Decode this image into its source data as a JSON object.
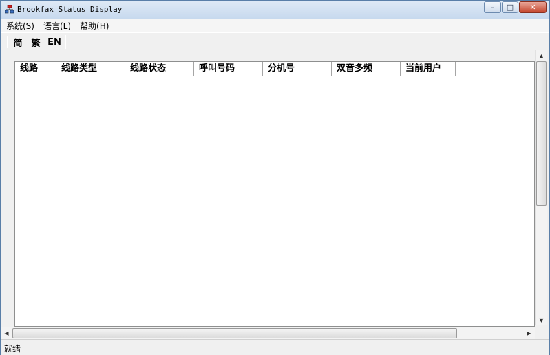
{
  "window": {
    "title": "Brookfax Status Display"
  },
  "window_buttons": {
    "minimize": "–",
    "maximize": "□",
    "close": "✕"
  },
  "menu": [
    {
      "label": "系统(S)"
    },
    {
      "label": "语言(L)"
    },
    {
      "label": "帮助(H)"
    }
  ],
  "toolbar": {
    "simplified": "简",
    "traditional": "繁",
    "english": "EN"
  },
  "table": {
    "columns": [
      "线路",
      "线路类型",
      "线路状态",
      "呼叫号码",
      "分机号",
      "双音多频",
      "当前用户"
    ]
  },
  "status": {
    "text": "就绪"
  },
  "icons": {
    "app": "network-computer-icon",
    "scroll_up": "arrow-up-icon",
    "scroll_down": "arrow-down-icon",
    "scroll_left": "arrow-left-icon",
    "scroll_right": "arrow-right-icon"
  },
  "colors": {
    "titlebar": "#c7d9ee",
    "close_button": "#c4452c"
  }
}
